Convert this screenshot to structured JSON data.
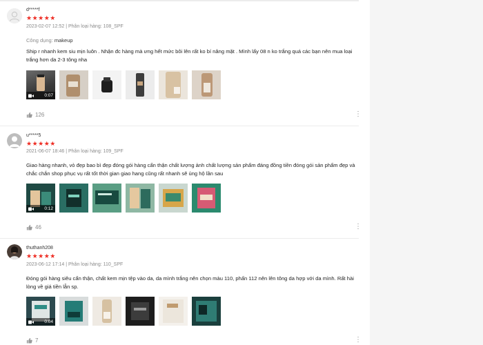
{
  "reviews": [
    {
      "username": "d*****f",
      "stars": "★★★★★",
      "datetime": "2023-02-07 12:52",
      "variation_label": "Phân loại hàng:",
      "variation": "108_SPF",
      "usage_label": "Công dụng:",
      "usage_value": "makeup",
      "content": "Ship r nhanh kem siu mịn luôn . Nhận đc hàng mà ưng hết mức bôi lên rất ko bí nâng mặt . Mình lấy 08 n ko trắng quá các bạn nên mua loại trắng hơn da 2-3 tông nha",
      "video_duration": "0:07",
      "likes": "126"
    },
    {
      "username": "u*****5",
      "stars": "★★★★★",
      "datetime": "2021-06-07 18:46",
      "variation_label": "Phân loại hàng:",
      "variation": "109_SPF",
      "content": "Giao hàng nhanh, vỏ đẹp bao bì đẹp đóng gói hàng cẩn thận chất lượng ảnh chất lượng sản phẩm đáng đồng tiền đóng gói sản phẩm đẹp và chắc chắn shop phục vụ rất tốt thời gian giao hang cũng rất nhanh sẽ ủng hộ lần sau",
      "video_duration": "0:12",
      "likes": "46"
    },
    {
      "username": "thuthanh208",
      "stars": "★★★★★",
      "datetime": "2023-06-12 17:14",
      "variation_label": "Phân loại hàng:",
      "variation": "110_SPF",
      "content": "Đóng gói hàng siêu cẩn thận, chất kem mịn tệp vào da, da mình trắng nên chọn màu 110, phấn 112 nên lên tông da hợp với da mình. Rất hài lòng về giá tiền lẫn sp.",
      "video_duration": "0:04",
      "likes": "7"
    }
  ],
  "icons": {
    "video": "video-camera-icon",
    "like": "thumbs-up-icon",
    "more": "more-vertical-icon",
    "avatar": "user-avatar-icon"
  },
  "colors": {
    "star": "#ee2d24",
    "muted": "#8a8a8a",
    "text": "#222222",
    "right_background": "#f5f5f5"
  }
}
